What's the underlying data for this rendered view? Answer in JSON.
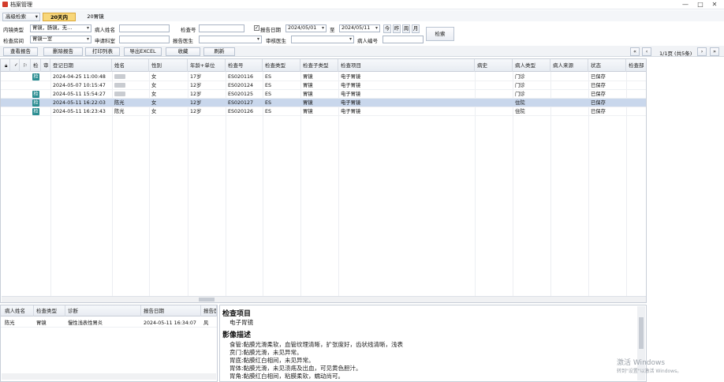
{
  "window": {
    "title": "档案管理",
    "min": "—",
    "max": "□",
    "close": "✕"
  },
  "query": {
    "advanced_search": "高级检索",
    "tabs": [
      "20天内",
      "20胃镜"
    ],
    "row1": {
      "endo_type_label": "内镜类型",
      "endo_type_value": "胃镜，肠镜，无…",
      "patient_name_label": "病人姓名",
      "patient_name_value": "",
      "exam_no_label": "检查号",
      "exam_no_value": "",
      "report_date_label": "报告日期",
      "date_from": "2024/05/01",
      "to_label": "至",
      "date_to": "2024/05/11",
      "quick": [
        "今",
        "昨",
        "周",
        "月"
      ]
    },
    "row2": {
      "room_label": "检查房间",
      "room_value": "胃镜一室",
      "dept_label": "申请科室",
      "dept_value": "",
      "doctor_label": "报告医生",
      "doctor_value": "",
      "reviewer_label": "审核医生",
      "reviewer_value": "",
      "patient_no_label": "病人编号",
      "patient_no_value": ""
    },
    "search_button": "检索"
  },
  "toolbar": {
    "buttons": [
      "查看报告",
      "删除报告",
      "打印列表",
      "导出EXCEL",
      "收藏",
      "刷新"
    ]
  },
  "pager": {
    "first": "«",
    "prev": "‹",
    "info": "1/1页 (共5条)",
    "next": "›",
    "last": "»"
  },
  "grid": {
    "columns": [
      "",
      "",
      "检",
      "审",
      "登记日期",
      "姓名",
      "性别",
      "年龄+单位",
      "检查号",
      "检查类型",
      "检查子类型",
      "检查项目",
      "病史",
      "病人类型",
      "病人来源",
      "状态",
      "检查部"
    ],
    "rows": [
      {
        "tag": "检",
        "date": "2024-04-25 11:00:48",
        "name": "",
        "sex": "女",
        "age": "17岁",
        "no": "ES020116",
        "type": "ES",
        "subtype": "胃镜",
        "item": "电子胃镜",
        "history": "",
        "ptype": "门诊",
        "source": "",
        "status": "已保存",
        "selected": false
      },
      {
        "tag": "",
        "date": "2024-05-07 10:15:47",
        "name": "",
        "sex": "女",
        "age": "12岁",
        "no": "ES020124",
        "type": "ES",
        "subtype": "胃镜",
        "item": "电子胃镜",
        "history": "",
        "ptype": "门诊",
        "source": "",
        "status": "已保存",
        "selected": false
      },
      {
        "tag": "检",
        "date": "2024-05-11 15:54:27",
        "name": "",
        "sex": "女",
        "age": "12岁",
        "no": "ES020125",
        "type": "ES",
        "subtype": "胃镜",
        "item": "电子胃镜",
        "history": "",
        "ptype": "门诊",
        "source": "",
        "status": "已保存",
        "selected": false
      },
      {
        "tag": "检",
        "date": "2024-05-11 16:22:03",
        "name": "陈光",
        "sex": "女",
        "age": "12岁",
        "no": "ES020127",
        "type": "ES",
        "subtype": "胃镜",
        "item": "电子胃镜",
        "history": "",
        "ptype": "住院",
        "source": "",
        "status": "已保存",
        "selected": true
      },
      {
        "tag": "检",
        "date": "2024-05-11 16:23:43",
        "name": "陈光",
        "sex": "女",
        "age": "12岁",
        "no": "ES020126",
        "type": "ES",
        "subtype": "胃镜",
        "item": "电子胃镜",
        "history": "",
        "ptype": "住院",
        "source": "",
        "status": "已保存",
        "selected": false
      }
    ]
  },
  "history": {
    "columns": [
      "病人姓名",
      "检查类型",
      "诊断",
      "报告日期",
      "报告医"
    ],
    "rows": [
      {
        "name": "陈光",
        "type": "胃镜",
        "diag": "慢性浅表性胃炎",
        "date": "2024-05-11 16:34:07",
        "doctor": "风"
      }
    ]
  },
  "detail": {
    "item_heading": "检查项目",
    "item_value": "电子胃镜",
    "desc_heading": "影像描述",
    "lines": [
      "食管:黏膜光滑柔软，血管纹理清晰，扩张度好，齿状线清晰，浅表",
      "贲门:黏膜光滑，未见异常。",
      "胃底:黏膜红白相间，未见异常。",
      "胃体:黏膜光滑，未见溃疡及出血，可见黄色胆汁。",
      "胃角:黏膜红白相间，粘膜柔软，蠕动尚可。"
    ]
  },
  "watermark": {
    "line1": "激活 Windows",
    "line2": "转到\"设置\"以激活 Windows。"
  }
}
